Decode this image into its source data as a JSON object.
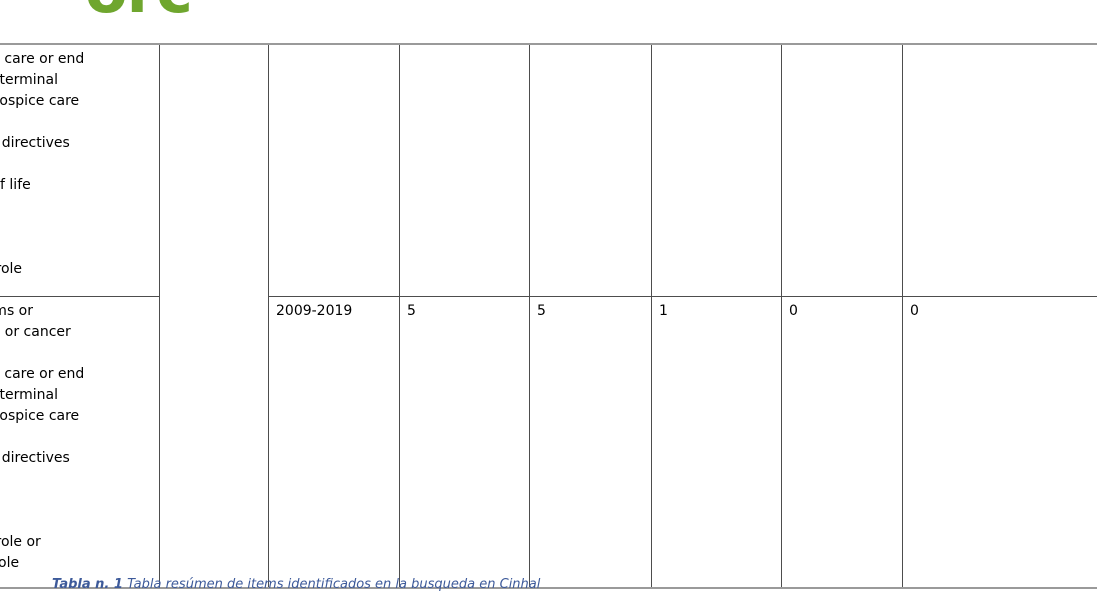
{
  "logo": {
    "mark_text": "orc",
    "sub_text": "",
    "accent_color": "#6fa62e"
  },
  "table": {
    "columns": [
      {
        "key": "query",
        "header": ""
      },
      {
        "key": "blank",
        "header": ""
      },
      {
        "key": "years",
        "header": ""
      },
      {
        "key": "n1",
        "header": ""
      },
      {
        "key": "n2",
        "header": ""
      },
      {
        "key": "n3",
        "header": ""
      },
      {
        "key": "n4",
        "header": ""
      },
      {
        "key": "n5",
        "header": ""
      }
    ],
    "rows": [
      {
        "query": "Palliative care or end\nof life or terminal\ncare or hospice care\nAND\nAdvance directives\nAND\nQuality of life\nAND\nP-value\nAND\nNursing role",
        "blank": "",
        "years": "",
        "n1": "",
        "n2": "",
        "n3": "",
        "n4": "",
        "n5": ""
      },
      {
        "query": "Neoplasms or\noncology or cancer\nAND\nPalliative care or end\nof life or terminal\ncare or hospice care\nAND\nAdvance directives\nAND\nP-value\nAND\nNursing role or\nnurse’s role",
        "blank": "",
        "years": "2009-2019",
        "n1": "5",
        "n2": "5",
        "n3": "1",
        "n4": "0",
        "n5": "0"
      }
    ]
  },
  "caption": {
    "label": "Tabla n. 1",
    "text": "Tabla resúmen de items identificados en la busqueda en Cinhal",
    "color": "#3d5a9a"
  }
}
